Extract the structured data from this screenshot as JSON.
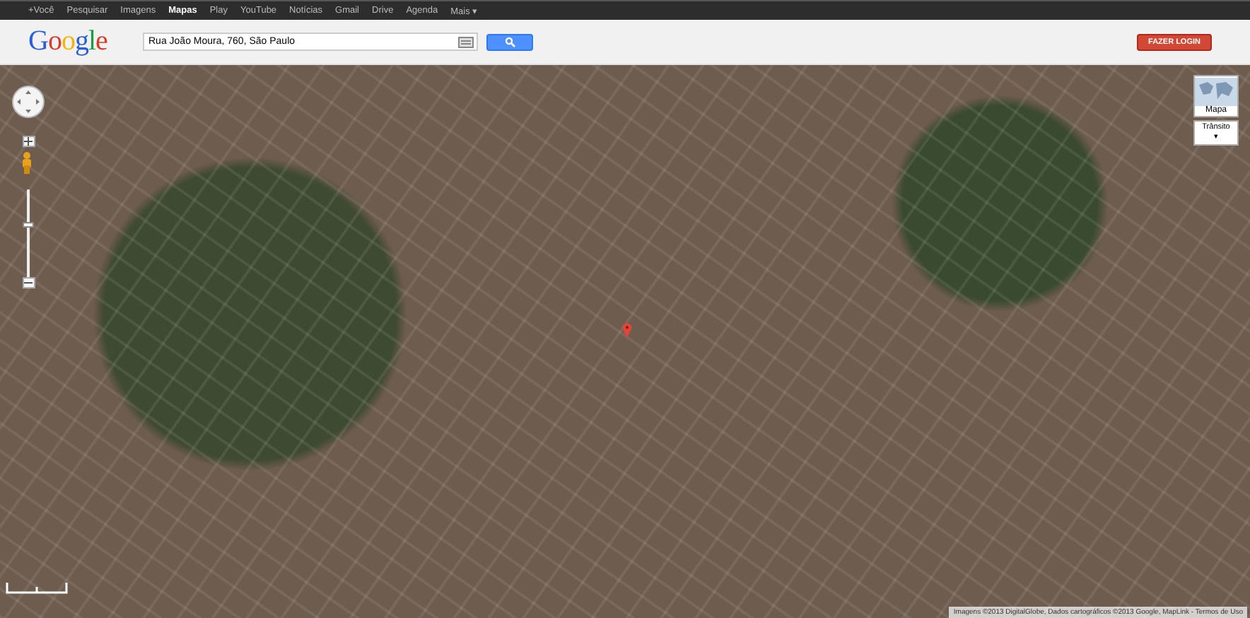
{
  "top_bar": {
    "items": [
      {
        "label": "+Você",
        "selected": false
      },
      {
        "label": "Pesquisar",
        "selected": false
      },
      {
        "label": "Imagens",
        "selected": false
      },
      {
        "label": "Mapas",
        "selected": true
      },
      {
        "label": "Play",
        "selected": false
      },
      {
        "label": "YouTube",
        "selected": false
      },
      {
        "label": "Notícias",
        "selected": false
      },
      {
        "label": "Gmail",
        "selected": false
      },
      {
        "label": "Drive",
        "selected": false
      },
      {
        "label": "Agenda",
        "selected": false
      },
      {
        "label": "Mais ▾",
        "selected": false
      }
    ]
  },
  "header": {
    "logo": "Google",
    "search": {
      "value": "Rua João Moura, 760, São Paulo"
    },
    "login_button": "FAZER LOGIN"
  },
  "map": {
    "zoom": {
      "level": 0.6
    },
    "map_type": {
      "label": "Mapa"
    },
    "traffic": {
      "label": "Trânsito",
      "caret": "▾"
    },
    "attribution": "Imagens ©2013 DigitalGlobe, Dados cartográficos ©2013 Google, MapLink - Termos de Uso"
  }
}
